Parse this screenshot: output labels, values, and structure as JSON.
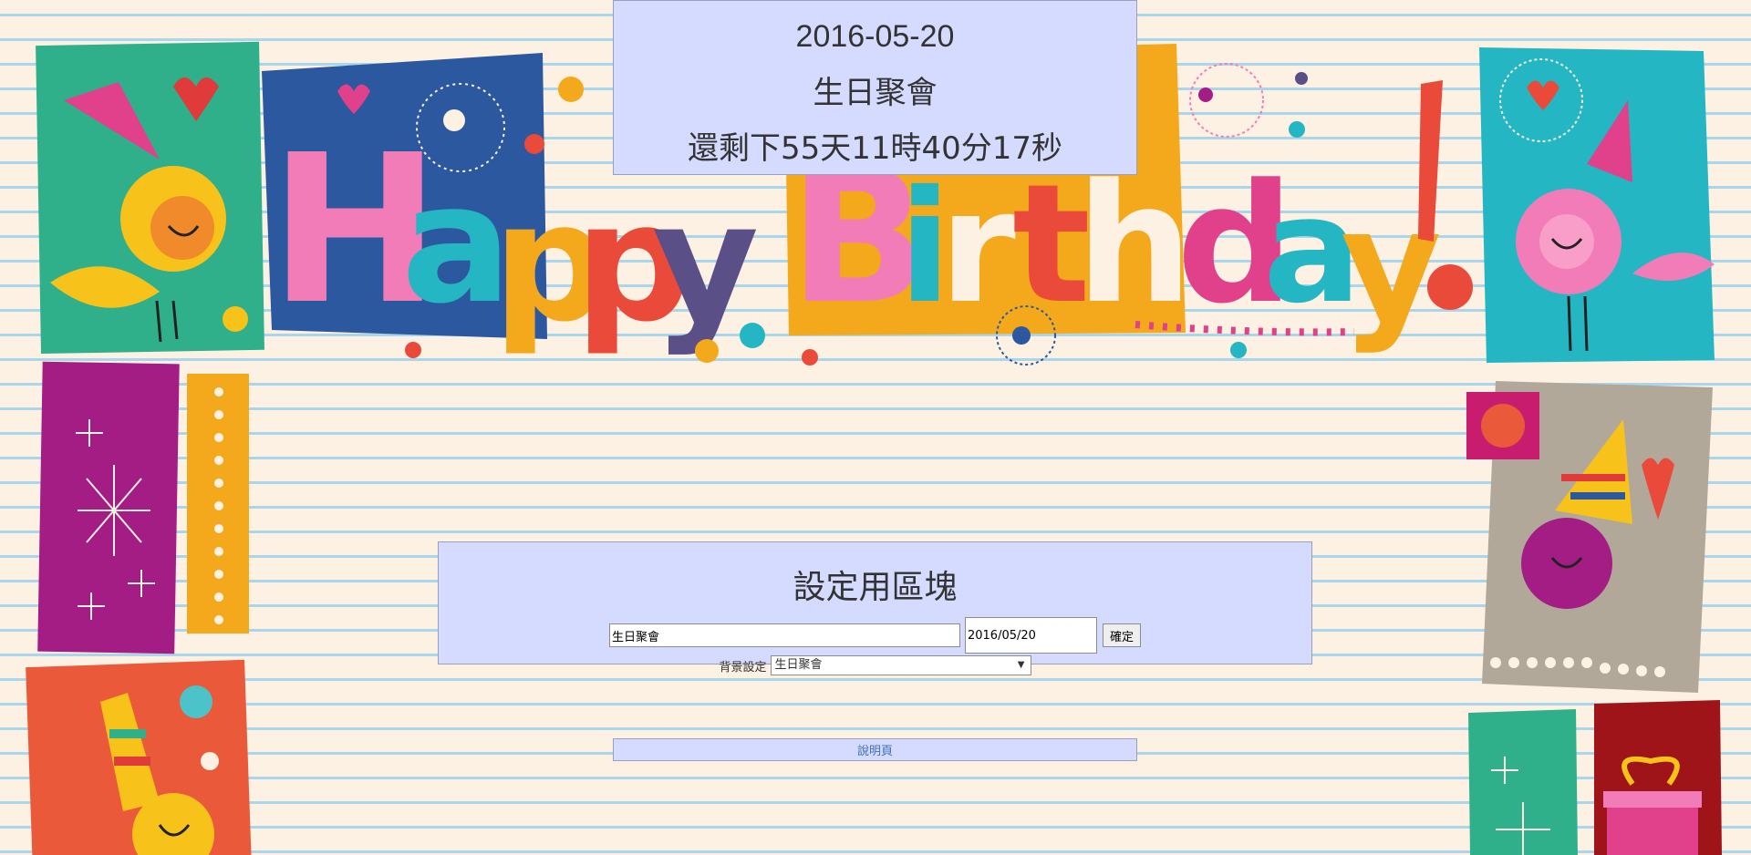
{
  "countdown": {
    "date": "2016-05-20",
    "event_name": "生日聚會",
    "remaining": "還剩下55天11時40分17秒"
  },
  "banner": {
    "text": "Happy Birthday!"
  },
  "settings": {
    "title": "設定用區塊",
    "event_value": "生日聚會",
    "date_value": "2016/05/20",
    "confirm_label": "確定",
    "background_label": "背景設定",
    "background_selected": "生日聚會"
  },
  "help_link": "說明頁",
  "colors": {
    "panel_bg": "#d4dbff",
    "page_bg": "#fdf1e3",
    "line": "#a9d6ea",
    "link": "#3f6fb7"
  }
}
